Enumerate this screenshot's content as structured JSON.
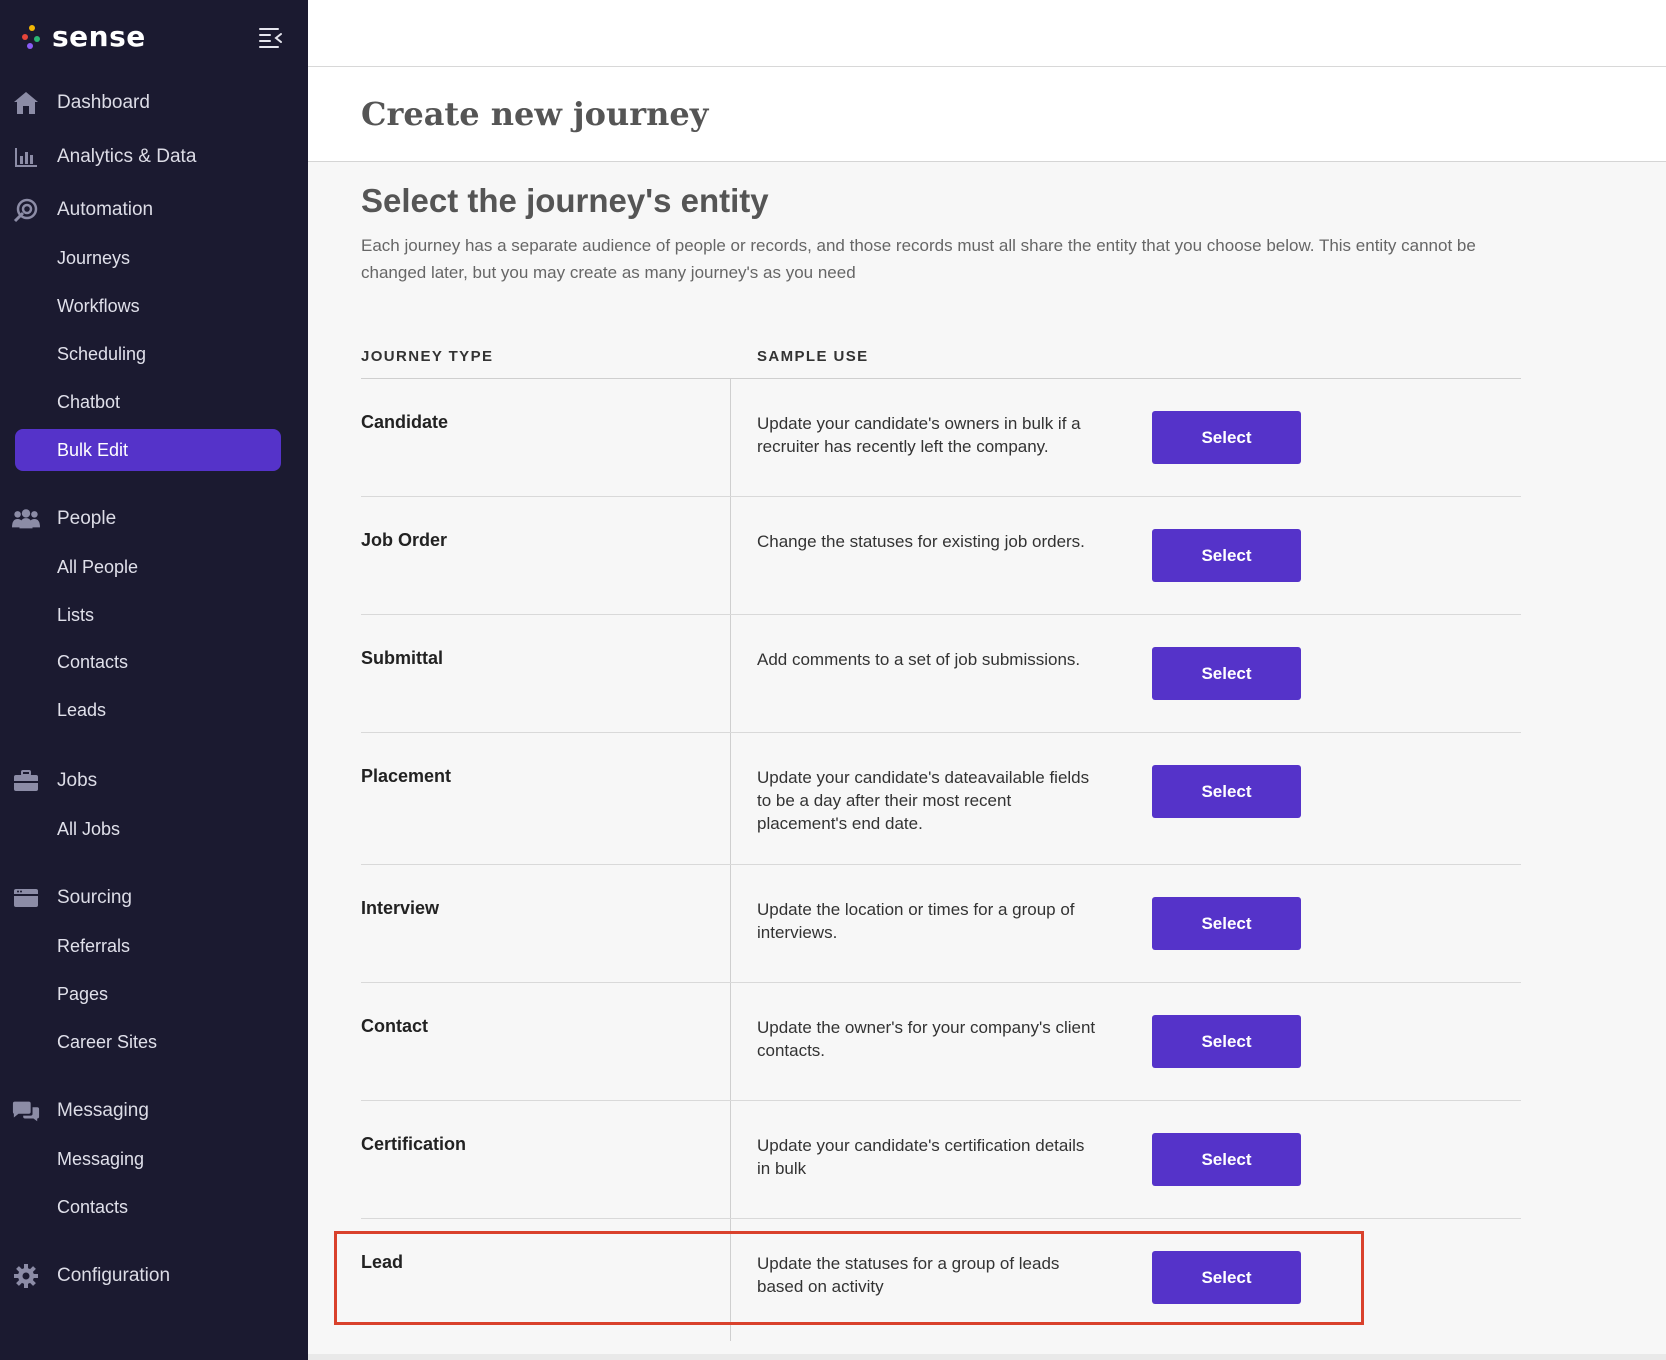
{
  "app": {
    "name": "sense",
    "colors": {
      "sidebar_bg": "#1b1a30",
      "accent": "#5533c9",
      "highlight": "#d9412c"
    }
  },
  "sidebar": {
    "sections": [
      {
        "label": "Dashboard",
        "icon": "home-icon",
        "items": []
      },
      {
        "label": "Analytics & Data",
        "icon": "bar-chart-icon",
        "items": []
      },
      {
        "label": "Automation",
        "icon": "automation-icon",
        "items": [
          "Journeys",
          "Workflows",
          "Scheduling",
          "Chatbot",
          "Bulk Edit"
        ]
      },
      {
        "label": "People",
        "icon": "people-icon",
        "items": [
          "All People",
          "Lists",
          "Contacts",
          "Leads"
        ]
      },
      {
        "label": "Jobs",
        "icon": "briefcase-icon",
        "items": [
          "All Jobs"
        ]
      },
      {
        "label": "Sourcing",
        "icon": "sourcing-icon",
        "items": [
          "Referrals",
          "Pages",
          "Career Sites"
        ]
      },
      {
        "label": "Messaging",
        "icon": "chat-bubbles-icon",
        "items": [
          "Messaging",
          "Contacts"
        ]
      },
      {
        "label": "Configuration",
        "icon": "gear-icon",
        "items": []
      }
    ],
    "active_item": "Bulk Edit"
  },
  "header": {
    "title": "Create new journey"
  },
  "main": {
    "section_title": "Select the journey's entity",
    "description": "Each journey has a separate audience of people or records, and those records must all share the entity that you choose below. This entity cannot be changed later, but you may create as many journey's as you need",
    "columns": [
      "JOURNEY TYPE",
      "SAMPLE USE"
    ],
    "select_label": "Select",
    "rows": [
      {
        "type": "Candidate",
        "use": "Update your candidate's owners in bulk if a recruiter has recently left the company."
      },
      {
        "type": "Job Order",
        "use": "Change the statuses for existing job orders."
      },
      {
        "type": "Submittal",
        "use": "Add comments to a set of job submissions."
      },
      {
        "type": "Placement",
        "use": "Update your candidate's dateavailable fields to be a day after their most recent placement's end date."
      },
      {
        "type": "Interview",
        "use": "Update the location or times for a group of interviews."
      },
      {
        "type": "Contact",
        "use": "Update the owner's for your company's client contacts."
      },
      {
        "type": "Certification",
        "use": "Update your candidate's certification details in bulk"
      },
      {
        "type": "Lead",
        "use": "Update the statuses for a group of leads based on activity"
      }
    ],
    "highlighted_row": "Lead"
  }
}
